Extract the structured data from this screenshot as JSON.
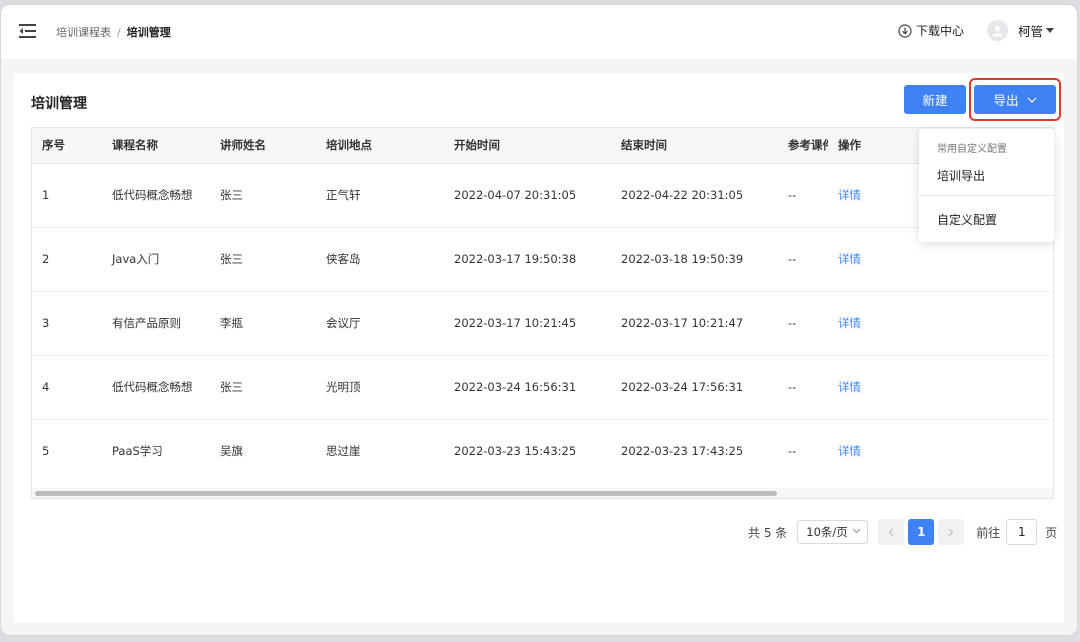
{
  "header": {
    "breadcrumb": [
      "培训课程表",
      "培训管理"
    ],
    "breadcrumb_sep": "/",
    "download_center": "下载中心",
    "username": "柯管"
  },
  "page": {
    "title": "培训管理",
    "new_button": "新建",
    "export_button": "导出"
  },
  "table": {
    "columns": [
      "序号",
      "课程名称",
      "讲师姓名",
      "培训地点",
      "开始时间",
      "结束时间",
      "参考课件",
      "操作"
    ],
    "rows": [
      {
        "index": "1",
        "course": "低代码概念畅想",
        "teacher": "张三",
        "location": "正气轩",
        "start": "2022-04-07 20:31:05",
        "end": "2022-04-22 20:31:05",
        "material": "--",
        "action": "详情"
      },
      {
        "index": "2",
        "course": "Java入门",
        "teacher": "张三",
        "location": "侠客岛",
        "start": "2022-03-17 19:50:38",
        "end": "2022-03-18 19:50:39",
        "material": "--",
        "action": "详情"
      },
      {
        "index": "3",
        "course": "有信产品原则",
        "teacher": "李瓶",
        "location": "会议厅",
        "start": "2022-03-17 10:21:45",
        "end": "2022-03-17 10:21:47",
        "material": "--",
        "action": "详情"
      },
      {
        "index": "4",
        "course": "低代码概念畅想",
        "teacher": "张三",
        "location": "光明顶",
        "start": "2022-03-24 16:56:31",
        "end": "2022-03-24 17:56:31",
        "material": "--",
        "action": "详情"
      },
      {
        "index": "5",
        "course": "PaaS学习",
        "teacher": "吴旗",
        "location": "思过崖",
        "start": "2022-03-23 15:43:25",
        "end": "2022-03-23 17:43:25",
        "material": "--",
        "action": "详情"
      }
    ]
  },
  "export_menu": {
    "group_label": "常用自定义配置",
    "items": [
      "培训导出",
      "自定义配置"
    ]
  },
  "pagination": {
    "total": "共 5 条",
    "page_size": "10条/页",
    "current_page": "1",
    "goto_label": "前往",
    "goto_value": "1",
    "goto_suffix": "页"
  },
  "colors": {
    "primary": "#3f82f6",
    "highlight_border": "#e0392c"
  }
}
